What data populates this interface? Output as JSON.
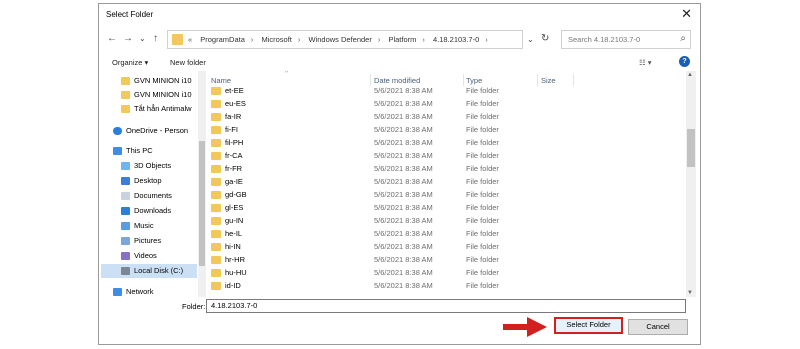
{
  "window": {
    "title": "Select Folder",
    "close_glyph": "✕"
  },
  "nav": {
    "back_glyph": "←",
    "forward_glyph": "→",
    "recent_glyph": "⌄",
    "up_glyph": "↑",
    "overflow": "«",
    "breadcrumbs": [
      "ProgramData",
      "Microsoft",
      "Windows Defender",
      "Platform",
      "4.18.2103.7-0"
    ],
    "refresh_glyph": "↻",
    "search_placeholder": "Search 4.18.2103.7-0"
  },
  "toolbar": {
    "organize": "Organize ▾",
    "new_folder": "New folder",
    "view_glyph": "☷ ▾",
    "help_glyph": "?"
  },
  "sidebar": {
    "items": [
      {
        "label": "GVN MINION i10",
        "icon": "folder-icon"
      },
      {
        "label": "GVN MINION i10",
        "icon": "folder-icon"
      },
      {
        "label": "Tắt hẳn Antimalw",
        "icon": "folder-icon"
      },
      {
        "label": "OneDrive - Person",
        "icon": "cloud-icon"
      },
      {
        "label": "This PC",
        "icon": "computer-icon"
      },
      {
        "label": "3D Objects",
        "icon": "cube-icon"
      },
      {
        "label": "Desktop",
        "icon": "desktop-icon"
      },
      {
        "label": "Documents",
        "icon": "document-icon"
      },
      {
        "label": "Downloads",
        "icon": "download-icon"
      },
      {
        "label": "Music",
        "icon": "music-icon"
      },
      {
        "label": "Pictures",
        "icon": "picture-icon"
      },
      {
        "label": "Videos",
        "icon": "video-icon"
      },
      {
        "label": "Local Disk (C:)",
        "icon": "disk-icon"
      },
      {
        "label": "Network",
        "icon": "network-icon"
      }
    ]
  },
  "columns": {
    "name": "Name",
    "date": "Date modified",
    "type": "Type",
    "size": "Size"
  },
  "files": [
    {
      "name": "et-EE",
      "date": "5/6/2021 8:38 AM",
      "type": "File folder"
    },
    {
      "name": "eu-ES",
      "date": "5/6/2021 8:38 AM",
      "type": "File folder"
    },
    {
      "name": "fa-IR",
      "date": "5/6/2021 8:38 AM",
      "type": "File folder"
    },
    {
      "name": "fi-FI",
      "date": "5/6/2021 8:38 AM",
      "type": "File folder"
    },
    {
      "name": "fil-PH",
      "date": "5/6/2021 8:38 AM",
      "type": "File folder"
    },
    {
      "name": "fr-CA",
      "date": "5/6/2021 8:38 AM",
      "type": "File folder"
    },
    {
      "name": "fr-FR",
      "date": "5/6/2021 8:38 AM",
      "type": "File folder"
    },
    {
      "name": "ga-IE",
      "date": "5/6/2021 8:38 AM",
      "type": "File folder"
    },
    {
      "name": "gd-GB",
      "date": "5/6/2021 8:38 AM",
      "type": "File folder"
    },
    {
      "name": "gl-ES",
      "date": "5/6/2021 8:38 AM",
      "type": "File folder"
    },
    {
      "name": "gu-IN",
      "date": "5/6/2021 8:38 AM",
      "type": "File folder"
    },
    {
      "name": "he-IL",
      "date": "5/6/2021 8:38 AM",
      "type": "File folder"
    },
    {
      "name": "hi-IN",
      "date": "5/6/2021 8:38 AM",
      "type": "File folder"
    },
    {
      "name": "hr-HR",
      "date": "5/6/2021 8:38 AM",
      "type": "File folder"
    },
    {
      "name": "hu-HU",
      "date": "5/6/2021 8:38 AM",
      "type": "File folder"
    },
    {
      "name": "id-ID",
      "date": "5/6/2021 8:38 AM",
      "type": "File folder"
    }
  ],
  "footer": {
    "folder_label": "Folder:",
    "folder_value": "4.18.2103.7-0",
    "select_button": "Select Folder",
    "cancel_button": "Cancel"
  },
  "colors": {
    "highlight": "#d21f1f",
    "folder": "#f2c85b",
    "selection": "#cce0f5"
  }
}
